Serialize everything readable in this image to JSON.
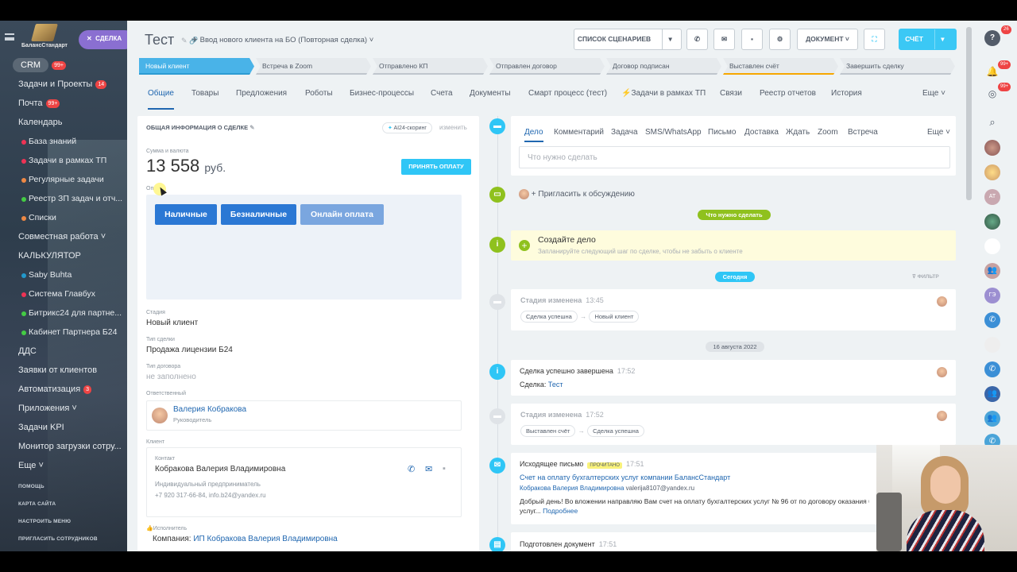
{
  "sidebar": {
    "deal_pill": "СДЕЛКА",
    "logo": "БалансСтандарт",
    "items": [
      {
        "label": "CRM",
        "count": "99+"
      },
      {
        "label": "Задачи и Проекты",
        "count": "14"
      },
      {
        "label": "Почта",
        "count": "99+"
      },
      {
        "label": "Календарь"
      },
      {
        "label": "База знаний"
      },
      {
        "label": "Задачи в рамках ТП"
      },
      {
        "label": "Регулярные задачи"
      },
      {
        "label": "Реестр ЗП задач и отч..."
      },
      {
        "label": "Списки"
      },
      {
        "label": "Совместная работа"
      },
      {
        "label": "КАЛЬКУЛЯТОР"
      },
      {
        "label": "Saby Buhta"
      },
      {
        "label": "Система Главбух"
      },
      {
        "label": "Битрикс24 для партне..."
      },
      {
        "label": "Кабинет Партнера Б24"
      },
      {
        "label": "ДДС"
      },
      {
        "label": "Заявки от клиентов"
      },
      {
        "label": "Автоматизация",
        "count": "3"
      },
      {
        "label": "Приложения"
      },
      {
        "label": "Задачи KPI"
      },
      {
        "label": "Монитор загрузки сотру..."
      },
      {
        "label": "Еще"
      }
    ],
    "footer": [
      "ПОМОЩЬ",
      "КАРТА САЙТА",
      "НАСТРОИТЬ МЕНЮ",
      "ПРИГЛАСИТЬ СОТРУДНИКОВ"
    ]
  },
  "header": {
    "title": "Тест",
    "subtitle": "Ввод нового клиента на БО (Повторная сделка)",
    "scenarios": "СПИСОК СЦЕНАРИЕВ",
    "document": "ДОКУМЕНТ",
    "invoice": "СЧЁТ"
  },
  "stages": [
    "Новый клиент",
    "Встреча в Zoom",
    "Отправлено КП",
    "Отправлен договор",
    "Договор подписан",
    "Выставлен счёт",
    "Завершить сделку"
  ],
  "tabs": [
    "Общие",
    "Товары",
    "Предложения",
    "Роботы",
    "Бизнес-процессы",
    "Счета",
    "Документы",
    "Смарт процесс (тест)",
    "Задачи в рамках ТП",
    "Связи",
    "Реестр отчетов",
    "История",
    "Еще"
  ],
  "deal": {
    "section_title": "ОБЩАЯ ИНФОРМАЦИЯ О СДЕЛКЕ",
    "ai_scoring": "AI24-скоринг",
    "edit": "изменить",
    "amount_label": "Сумма и валюта",
    "amount": "13 558",
    "currency": "руб.",
    "accept_payment": "ПРИНЯТЬ ОПЛАТУ",
    "pay_label": "Оп",
    "pay_buttons": [
      "Наличные",
      "Безналичные",
      "Онлайн оплата"
    ],
    "stage_label": "Стадия",
    "stage": "Новый клиент",
    "type_label": "Тип сделки",
    "type": "Продажа лицензии Б24",
    "contract_label": "Тип договора",
    "contract": "не заполнено",
    "resp_label": "Ответственный",
    "resp_name": "Валерия Кобракова",
    "resp_role": "Руководитель",
    "client_label": "Клиент",
    "contact_label": "Контакт",
    "contact_name": "Кобракова Валерия Владимировна",
    "contact_company": "Индивидуальный предприниматель",
    "contact_info": "+7 920 317-66-84, info.b24@yandex.ru",
    "executor_label": "Исполнитель",
    "company_label": "Компания:",
    "company": "ИП Кобракова Валерия Владимировна"
  },
  "timeline": {
    "tabs": [
      "Дело",
      "Комментарий",
      "Задача",
      "SMS/WhatsApp",
      "Письмо",
      "Доставка",
      "Ждать",
      "Zoom",
      "Встреча",
      "Еще"
    ],
    "placeholder": "Что нужно сделать",
    "invite": "Пригласить к обсуждению",
    "todo_pill": "Что нужно сделать",
    "create_title": "Создайте дело",
    "create_sub": "Запланируйте следующий шаг по сделке, чтобы не забыть о клиенте",
    "today": "Сегодня",
    "filter": "ФИЛЬТР",
    "e1_title": "Стадия изменена",
    "e1_time": "13:45",
    "e1_from": "Сделка успешна",
    "e1_to": "Новый клиент",
    "date2": "16 августа 2022",
    "e2_title": "Сделка успешно завершена",
    "e2_time": "17:52",
    "e2_text": "Сделка:",
    "e2_link": "Тест",
    "e3_title": "Стадия изменена",
    "e3_time": "17:52",
    "e3_from": "Выставлен счёт",
    "e3_to": "Сделка успешна",
    "e4_title": "Исходящее письмо",
    "e4_badge": "ПРОЧИТАНО",
    "e4_time": "17:51",
    "e4_subject": "Счет на оплату бухгалтерских услуг компании БалансСтандарт",
    "e4_from": "Кобракова Валерия Владимировна",
    "e4_email": "valerija8107@yandex.ru",
    "e4_body": "Добрый день! Во вложении направляю Вам счет на оплату бухгалтерских услуг № 96 от по договору оказания б",
    "e4_body2": "услуг...",
    "e4_more": "Подробнее",
    "e5_title": "Подготовлен документ",
    "e5_time": "17:51"
  },
  "right": {
    "badge1": "26",
    "badge2": "99+",
    "badge3": "99+",
    "initials1": "АТ",
    "initials2": "ГЭ"
  },
  "colors": {
    "accent": "#2067b0",
    "stage_active": "#49b3e8",
    "pay_button": "#2b78d4",
    "green": "#8fc11e",
    "timeline_blue": "#2fc6f6"
  }
}
